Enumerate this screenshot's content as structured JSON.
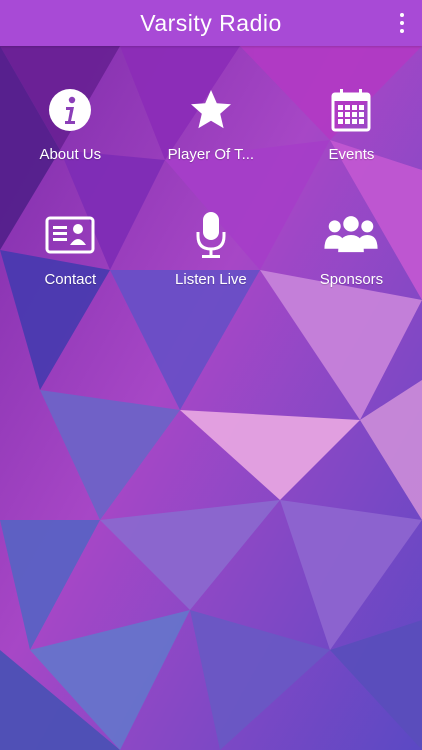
{
  "app": {
    "title": "Varsity Radio",
    "colors": {
      "header": "#a84ad6",
      "text": "#ffffff"
    }
  },
  "menu": {
    "items": [
      {
        "label": "About Us",
        "icon": "info-icon"
      },
      {
        "label": "Player Of T...",
        "icon": "star-icon"
      },
      {
        "label": "Events",
        "icon": "calendar-icon"
      },
      {
        "label": "Contact",
        "icon": "contact-card-icon"
      },
      {
        "label": "Listen Live",
        "icon": "microphone-icon"
      },
      {
        "label": "Sponsors",
        "icon": "users-icon"
      }
    ]
  }
}
